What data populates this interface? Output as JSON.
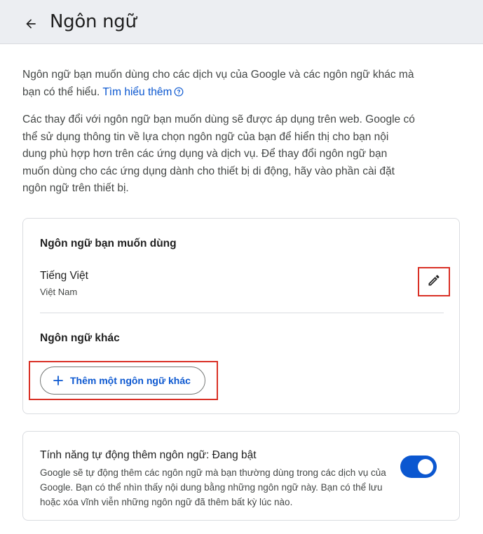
{
  "header": {
    "title": "Ngôn ngữ",
    "back_icon": "arrow-left-icon"
  },
  "intro": {
    "text": "Ngôn ngữ bạn muốn dùng cho các dịch vụ của Google và các ngôn ngữ khác mà bạn có thể hiểu.",
    "learn_more": "Tìm hiểu thêm",
    "help_icon": "help-circle-icon"
  },
  "info": {
    "text": "Các thay đổi với ngôn ngữ bạn muốn dùng sẽ được áp dụng trên web. Google có thể sử dụng thông tin về lựa chọn ngôn ngữ của bạn để hiển thị cho bạn nội dung phù hợp hơn trên các ứng dụng và dịch vụ. Để thay đổi ngôn ngữ bạn muốn dùng cho các ứng dụng dành cho thiết bị di động, hãy vào phần cài đặt ngôn ngữ trên thiết bị."
  },
  "preferred": {
    "title": "Ngôn ngữ bạn muốn dùng",
    "language": "Tiếng Việt",
    "region": "Việt Nam",
    "edit_icon": "pencil-icon"
  },
  "other": {
    "title": "Ngôn ngữ khác",
    "add_button": "Thêm một ngôn ngữ khác",
    "add_icon": "plus-icon"
  },
  "auto_add": {
    "title": "Tính năng tự động thêm ngôn ngữ: Đang bật",
    "description": "Google sẽ tự động thêm các ngôn ngữ mà bạn thường dùng trong các dịch vụ của Google. Bạn có thể nhìn thấy nội dung bằng những ngôn ngữ này. Bạn có thể lưu hoặc xóa vĩnh viễn những ngôn ngữ đã thêm bất kỳ lúc nào.",
    "enabled": true
  },
  "colors": {
    "accent": "#0b57d0",
    "header_bg": "#eceef2",
    "highlight": "#d93025",
    "border": "#dadce0"
  }
}
